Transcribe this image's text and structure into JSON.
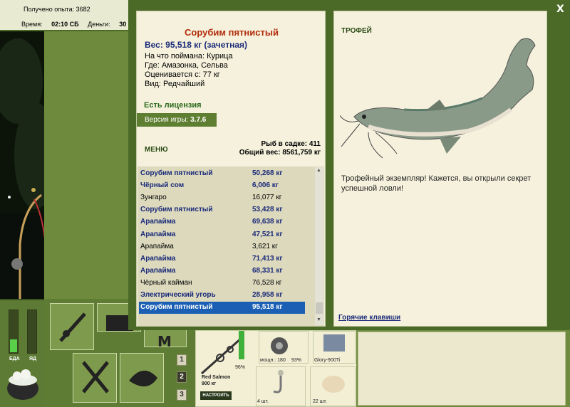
{
  "hud": {
    "xp_label": "Получено опыта: 3682",
    "time_label": "Время:",
    "time_value": "02:10 СБ",
    "money_label": "Деньги:",
    "money_value": "30"
  },
  "meters": {
    "food_label": "ЕДА",
    "bait_label": "ЯД",
    "food_level": 0.3,
    "bait_level": 0.0
  },
  "catch": {
    "title": "Сорубим пятнистый",
    "weight": "Вес: 95,518 кг (зачетная)",
    "details": [
      "На что поймана: Курица",
      "Где: Амазонка, Сельва",
      "Оценивается с: 77 кг",
      "Вид: Редчайший"
    ],
    "license": "Есть лицензия",
    "version_label": "Версия игры:",
    "version": "3.7.6",
    "menu": "МЕНЮ",
    "fish_in_net": "Рыб в садке: 411",
    "total_weight": "Общий вес: 8561,759 кг"
  },
  "fish_list": [
    {
      "name": "Сорубим пятнистый",
      "weight": "50,268 кг",
      "style": "bold"
    },
    {
      "name": "Чёрный сом",
      "weight": "6,006 кг",
      "style": "bold"
    },
    {
      "name": "Зунгаро",
      "weight": "16,077 кг",
      "style": "plain"
    },
    {
      "name": "Сорубим пятнистый",
      "weight": "53,428 кг",
      "style": "bold"
    },
    {
      "name": "Арапайма",
      "weight": "69,638 кг",
      "style": "bold"
    },
    {
      "name": "Арапайма",
      "weight": "47,521 кг",
      "style": "bold"
    },
    {
      "name": "Арапайма",
      "weight": "3,621 кг",
      "style": "plain"
    },
    {
      "name": "Арапайма",
      "weight": "71,413 кг",
      "style": "bold"
    },
    {
      "name": "Арапайма",
      "weight": "68,331 кг",
      "style": "bold"
    },
    {
      "name": "Чёрный кайман",
      "weight": "76,528 кг",
      "style": "plain"
    },
    {
      "name": "Электрический угорь",
      "weight": "28,958 кг",
      "style": "bold"
    },
    {
      "name": "Сорубим пятнистый",
      "weight": "95,518 кг",
      "style": "sel"
    }
  ],
  "trophy": {
    "label": "ТРОФЕЙ",
    "description": "Трофейный экземпляр! Кажется, вы открыли секрет успешной ловли!",
    "hotkeys": "Горячие клавиши"
  },
  "tackle": {
    "rod_name": "Red Salmon",
    "rod_weight": "900 кг",
    "rod_pct": "96%",
    "reel_label": "мощн.: 180",
    "reel_pct": "93%",
    "line_name": "Glory-900Ti",
    "hook_count": "4 шт.",
    "bait_count": "22 шт.",
    "setup_button": "НАСТРОИТЬ"
  },
  "pages": [
    "1",
    "2",
    "3"
  ],
  "close": "X",
  "colors": {
    "title": "#b22b0b",
    "name_blue": "#1a2a7a",
    "selection": "#1a5fb4",
    "frame_green": "#4b6a28"
  }
}
